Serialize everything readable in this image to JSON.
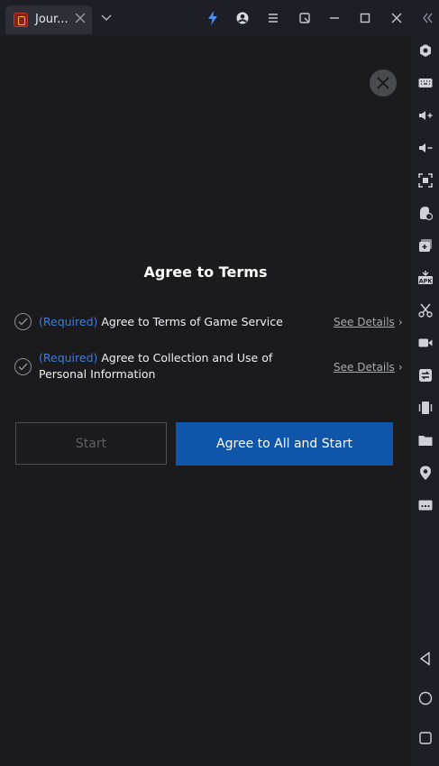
{
  "window": {
    "tab_title": "Jour...",
    "icons": [
      "lightning-icon",
      "account-icon",
      "menu-icon",
      "expand-icon",
      "minimize-icon",
      "maximize-icon",
      "close-icon",
      "collapse-sidebar-icon"
    ]
  },
  "dialog": {
    "title": "Agree to Terms",
    "terms": [
      {
        "required": "(Required)",
        "text": " Agree to Terms of Game Service",
        "details": "See Details"
      },
      {
        "required": "(Required)",
        "text": " Agree to Collection and Use of Personal Information",
        "details": "See Details"
      }
    ],
    "start_label": "Start",
    "agree_all_label": "Agree to All and Start"
  },
  "sidebar": {
    "icons": [
      "settings-icon",
      "keyboard-icon",
      "volume-up-icon",
      "volume-down-icon",
      "screenshot-icon",
      "rotate-icon",
      "multi-instance-icon",
      "apk-icon",
      "scissors-icon",
      "record-icon",
      "sync-icon",
      "shake-icon",
      "folder-icon",
      "location-icon",
      "more-icon",
      "back-icon",
      "home-icon",
      "recents-icon"
    ]
  },
  "colors": {
    "accent_blue": "#0f55aa",
    "required_blue": "#3d7de0",
    "background": "#1b1b1d"
  }
}
